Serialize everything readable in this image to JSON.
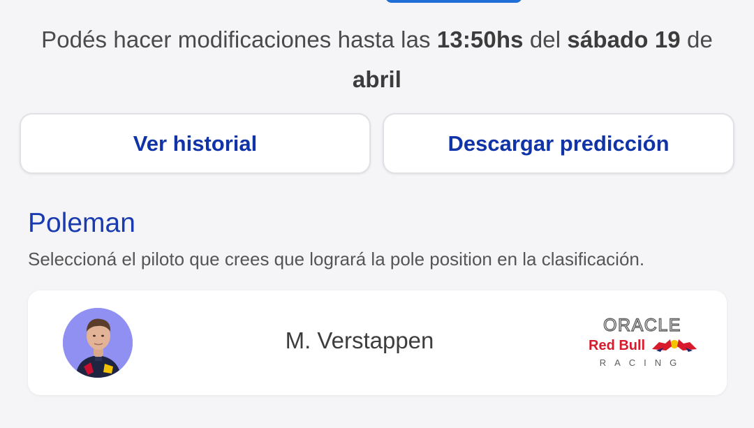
{
  "deadline": {
    "prefix": "Podés hacer modificaciones hasta las ",
    "time": "13:50hs",
    "middle": " del ",
    "date": "sábado 19",
    "suffix": " de",
    "month": "abril"
  },
  "buttons": {
    "history_label": "Ver historial",
    "download_label": "Descargar predicción"
  },
  "section": {
    "title": "Poleman",
    "subtitle": "Seleccioná el piloto que crees que logrará la pole position en la clasificación."
  },
  "driver": {
    "name": "M. Verstappen",
    "avatar_bg": "#8f90f2",
    "team_logo": {
      "line1": "ORACLE",
      "line2": "Red Bull",
      "line3": "RACING"
    }
  },
  "colors": {
    "accent": "#1a3bb0",
    "button_text": "#1033a8",
    "background": "#f5f5f7"
  }
}
